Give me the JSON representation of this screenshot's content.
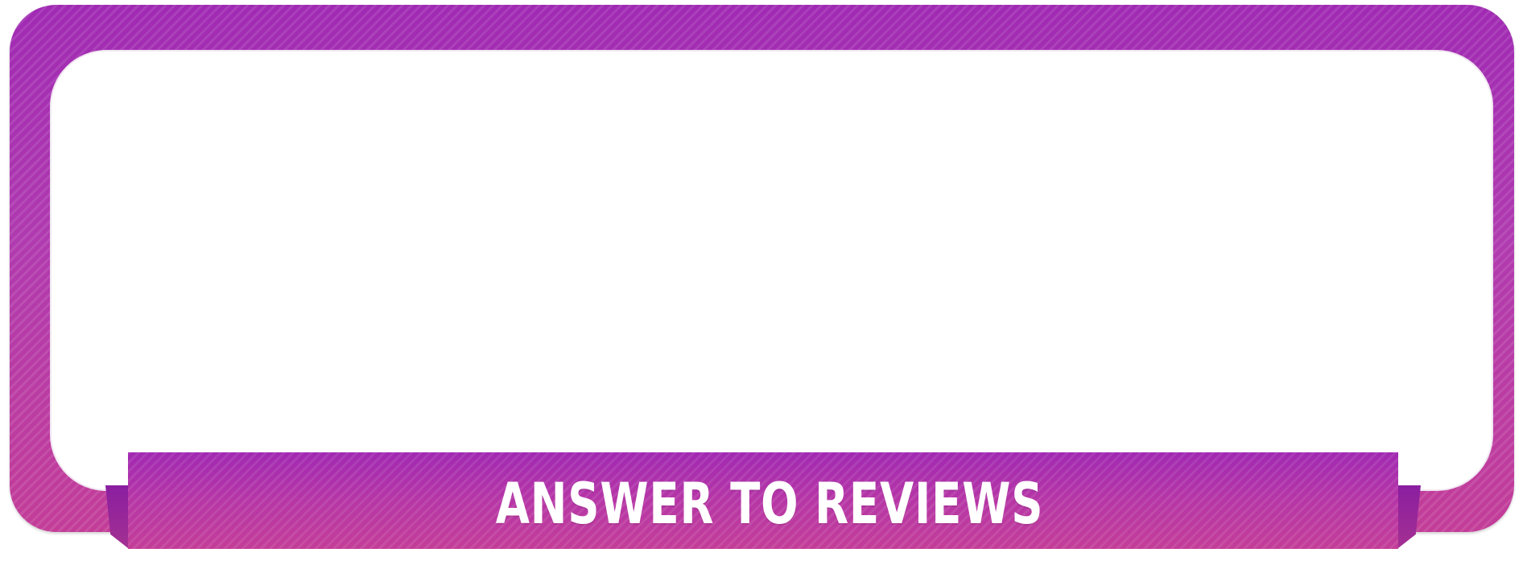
{
  "banner": {
    "title": "ANSWER TO REVIEWS"
  },
  "colors": {
    "frame_primary": "#a02ab3",
    "frame_secondary": "#c33d98",
    "inner_panel": "#ffffff",
    "title_text": "#ffffff"
  }
}
